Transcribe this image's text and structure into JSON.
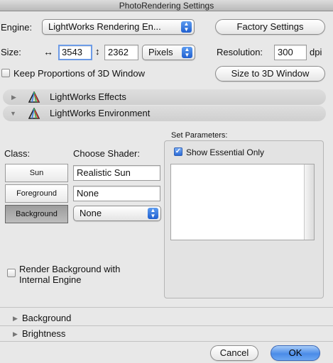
{
  "window": {
    "title": "PhotoRendering Settings"
  },
  "engine": {
    "label": "Engine:",
    "value": "LightWorks Rendering En...",
    "factory_button": "Factory Settings"
  },
  "size": {
    "label": "Size:",
    "width_icon": "↔",
    "width": "3543",
    "height_icon": "↕",
    "height": "2362",
    "unit": "Pixels",
    "resolution_label": "Resolution:",
    "resolution": "300",
    "resolution_unit": "dpi"
  },
  "proportions": {
    "label": "Keep Proportions of 3D Window",
    "checked": false,
    "size_button": "Size to 3D Window"
  },
  "sections": {
    "effects": "LightWorks Effects",
    "environment": "LightWorks Environment",
    "background": "Background",
    "brightness": "Brightness"
  },
  "environment": {
    "class_label": "Class:",
    "shader_label": "Choose Shader:",
    "classes": [
      "Sun",
      "Foreground",
      "Background"
    ],
    "active_class": "Background",
    "shaders": [
      "Realistic Sun",
      "None",
      "None"
    ],
    "set_parameters_label": "Set Parameters:",
    "show_essential_label": "Show Essential Only",
    "render_background_label_line1": "Render Background with",
    "render_background_label_line2": "Internal Engine"
  },
  "buttons": {
    "cancel": "Cancel",
    "ok": "OK"
  },
  "icons": {
    "section_icon": "lightworks-icon",
    "collapsed": "disclosure-right-icon",
    "expanded": "disclosure-down-icon"
  },
  "colors": {
    "accent": "#3f7fe0",
    "active_class": "#a9a9a9"
  }
}
